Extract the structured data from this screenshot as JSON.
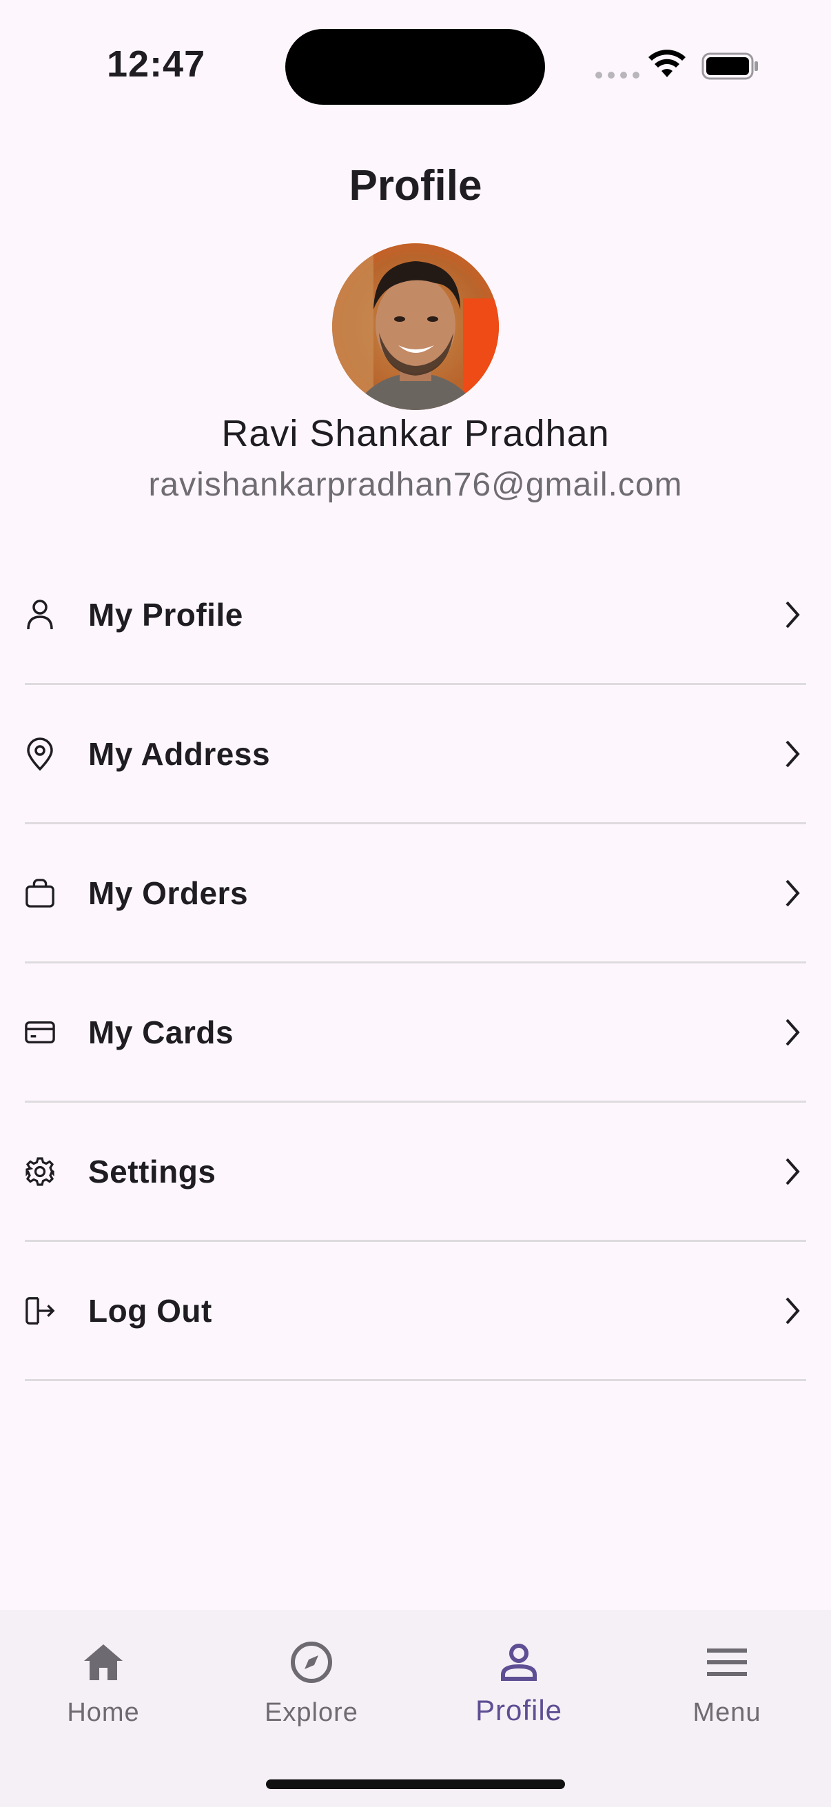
{
  "status_bar": {
    "time": "12:47"
  },
  "header": {
    "title": "Profile"
  },
  "user": {
    "name": "Ravi Shankar Pradhan",
    "email": "ravishankarpradhan76@gmail.com"
  },
  "menu": {
    "items": [
      {
        "label": "My Profile",
        "icon": "person-icon"
      },
      {
        "label": "My Address",
        "icon": "location-pin-icon"
      },
      {
        "label": "My Orders",
        "icon": "shopping-bag-icon"
      },
      {
        "label": "My Cards",
        "icon": "credit-card-icon"
      },
      {
        "label": "Settings",
        "icon": "gear-icon"
      },
      {
        "label": "Log Out",
        "icon": "logout-icon"
      }
    ]
  },
  "bottom_nav": {
    "items": [
      {
        "label": "Home",
        "icon": "home-icon",
        "active": false
      },
      {
        "label": "Explore",
        "icon": "compass-icon",
        "active": false
      },
      {
        "label": "Profile",
        "icon": "person-icon",
        "active": true
      },
      {
        "label": "Menu",
        "icon": "hamburger-menu-icon",
        "active": false
      }
    ]
  },
  "colors": {
    "background": "#fdf7fd",
    "nav_background": "#f5eff6",
    "accent": "#5e4e93",
    "text_primary": "#1f1d21",
    "text_secondary": "#6f6b72",
    "divider": "#dedbde"
  }
}
